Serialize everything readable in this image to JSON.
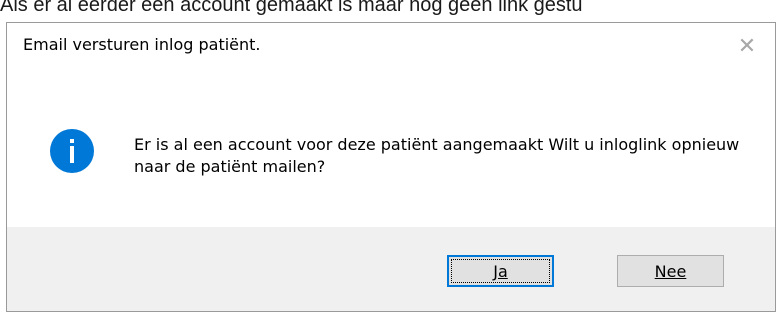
{
  "background": {
    "caption": "Als er al eerder een account gemaakt is maar nog geen link gestu"
  },
  "dialog": {
    "title": "Email versturen inlog patiënt.",
    "close_glyph": "✕",
    "icon": "info-icon",
    "message": "Er is al een account voor deze patiënt aangemaakt Wilt u inloglink opnieuw naar de patiënt mailen?",
    "buttons": {
      "yes_label": "Ja",
      "no_label": "Nee"
    }
  },
  "colors": {
    "icon_blue": "#0078d7",
    "footer_bg": "#f0f0f0",
    "button_bg": "#e1e1e1",
    "focus_border": "#0078d7"
  }
}
